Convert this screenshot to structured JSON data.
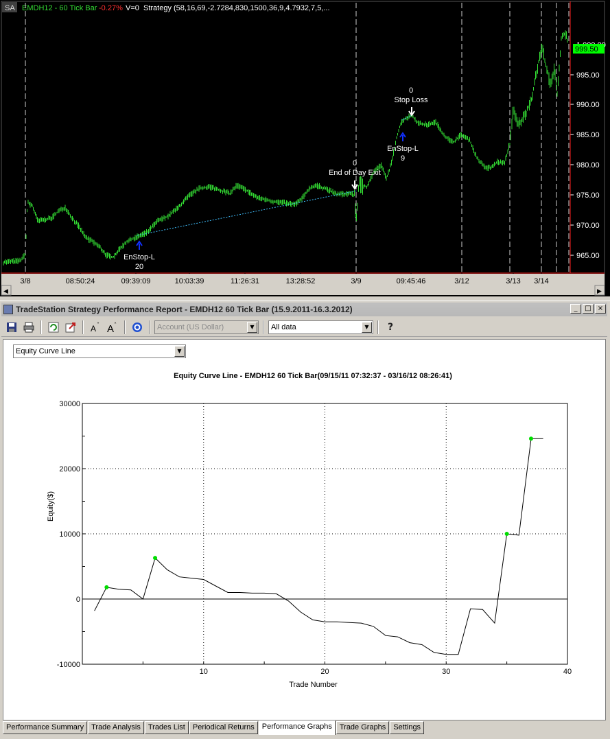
{
  "price_chart": {
    "sa_label": "SA",
    "symbol": "EMDH12 - 60 Tick Bar",
    "change": "-0.27%",
    "volume": "V=0",
    "strategy": "Strategy (58,16,69,-2.7284,830,1500,36,9,4.7932,7,5,...",
    "last_price": "999.50",
    "y_labels": [
      "965.00",
      "970.00",
      "975.00",
      "980.00",
      "985.00",
      "990.00",
      "995.00",
      "1,000.00"
    ],
    "x_labels": [
      "3/8",
      "08:50:24",
      "09:39:09",
      "10:03:39",
      "11:26:31",
      "13:28:52",
      "3/9",
      "09:45:46",
      "3/12",
      "3/13",
      "3/14"
    ],
    "annotations": [
      {
        "line1": "EnStop-L",
        "line2": "20"
      },
      {
        "line1": "0",
        "line2": "End of Day Exit"
      },
      {
        "line1": "EnStop-L",
        "line2": "9"
      },
      {
        "line1": "0",
        "line2": "Stop Loss"
      }
    ],
    "colors": {
      "bars": "#33dd33",
      "entry": "#1030ff",
      "exit": "#ffffff",
      "trade_line": "#40c0ff",
      "last_price_bg": "#00ff00"
    }
  },
  "window": {
    "title": "TradeStation Strategy Performance Report - EMDH12 60 Tick Bar (15.9.2011-16.3.2012)",
    "buttons": [
      "_",
      "□",
      "×"
    ]
  },
  "toolbar": {
    "account_select": "Account (US Dollar)",
    "range_select": "All data",
    "help_icon": "?"
  },
  "graph_select": "Equity Curve Line",
  "tabs": [
    "Performance Summary",
    "Trade Analysis",
    "Trades List",
    "Periodical Returns",
    "Performance Graphs",
    "Trade Graphs",
    "Settings"
  ],
  "active_tab": "Performance Graphs",
  "chart_data": {
    "type": "line",
    "title": "Equity Curve Line - EMDH12 60 Tick Bar(09/15/11 07:32:37 - 03/16/12 08:26:41)",
    "xlabel": "Trade Number",
    "ylabel": "Equity($)",
    "xlim": [
      0,
      40
    ],
    "ylim": [
      -10000,
      30000
    ],
    "x_ticks": [
      "10",
      "20",
      "30",
      "40"
    ],
    "y_ticks": [
      "-10000",
      "0",
      "10000",
      "20000",
      "30000"
    ],
    "grid": "dotted",
    "x": [
      1,
      2,
      3,
      4,
      5,
      6,
      7,
      8,
      9,
      10,
      11,
      12,
      13,
      14,
      15,
      16,
      17,
      18,
      19,
      20,
      21,
      22,
      23,
      24,
      25,
      26,
      27,
      28,
      29,
      30,
      31,
      32,
      33,
      34,
      35,
      36,
      37,
      38
    ],
    "y": [
      -1800,
      1800,
      1500,
      1400,
      0,
      6300,
      4500,
      3400,
      3200,
      3000,
      2000,
      1000,
      1000,
      900,
      900,
      800,
      -300,
      -2000,
      -3200,
      -3500,
      -3500,
      -3600,
      -3700,
      -4200,
      -5600,
      -5800,
      -6700,
      -7000,
      -8200,
      -8500,
      -8500,
      -1500,
      -1600,
      -3700,
      10000,
      9800,
      24600,
      24600
    ],
    "highlight_points": [
      2,
      6,
      35,
      37
    ],
    "line_color": "#000000",
    "highlight_color": "#00dd00"
  }
}
